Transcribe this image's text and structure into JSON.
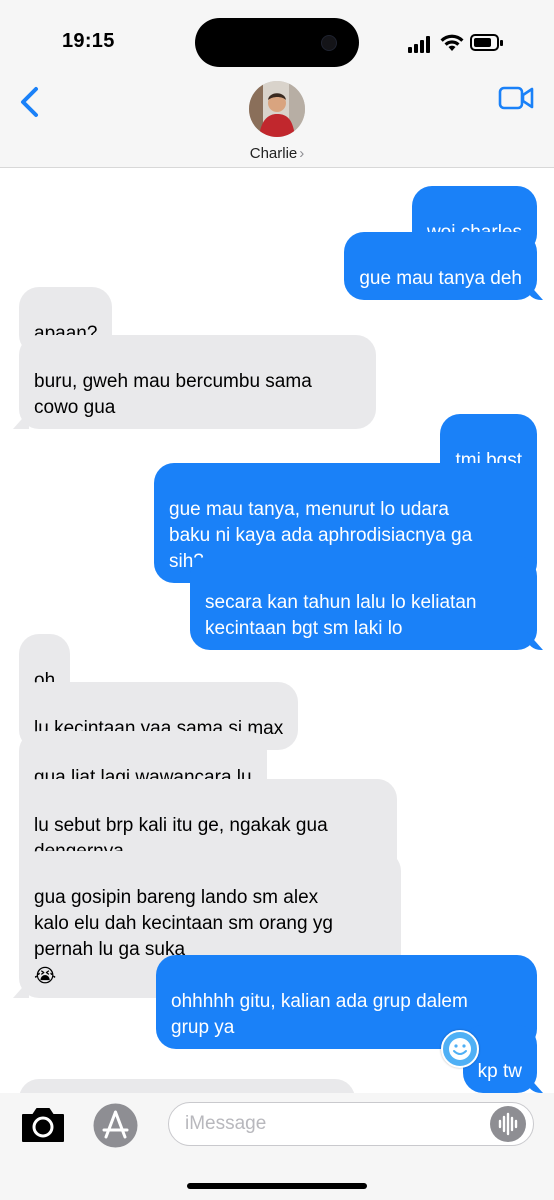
{
  "status_bar": {
    "time": "19:15"
  },
  "header": {
    "contact_name": "Charlie",
    "contact_chevron": "›"
  },
  "messages": [
    {
      "dir": "sent",
      "text": "woi charles"
    },
    {
      "dir": "sent",
      "text": "gue mau tanya deh"
    },
    {
      "dir": "recv",
      "text": "apaan?"
    },
    {
      "dir": "recv",
      "text": "buru, gweh mau bercumbu sama\ncowo gua"
    },
    {
      "dir": "sent",
      "text": "tmi bgst",
      "emoji": "😊"
    },
    {
      "dir": "sent",
      "text": "gue mau tanya, menurut lo udara\nbaku ni kaya ada aphrodisiacnya ga\nsih?"
    },
    {
      "dir": "sent",
      "text": "secara kan tahun lalu lo keliatan\nkecintaan bgt sm laki lo"
    },
    {
      "dir": "recv",
      "text": "oh",
      "emoji": "😏"
    },
    {
      "dir": "recv",
      "text": "lu kecintaan yaa sama si max"
    },
    {
      "dir": "recv",
      "text": "gua liat lagi wawancara lu",
      "emoji": "😭"
    },
    {
      "dir": "recv",
      "text": "lu sebut brp kali itu ge, ngakak gua\ndengernya",
      "emoji": "😭"
    },
    {
      "dir": "recv",
      "text": "gua gosipin bareng lando sm alex\nkalo elu dah kecintaan sm orang yg\npernah lu ga suka",
      "emoji": "😭"
    },
    {
      "dir": "sent",
      "text": "ohhhhh gitu, kalian ada grup dalem\ngrup ya"
    },
    {
      "dir": "sent",
      "text": "kp tw"
    }
  ],
  "composer": {
    "placeholder": "iMessage"
  },
  "icons": {
    "back": "chevron-left-icon",
    "video": "video-camera-icon",
    "camera": "camera-icon",
    "apps": "app-store-icon",
    "audio": "waveform-icon",
    "sticker": "sticker-icon"
  },
  "colors": {
    "sent_bubble": "#1a81f8",
    "received_bubble": "#e9e9eb",
    "accent": "#1a81f8"
  }
}
